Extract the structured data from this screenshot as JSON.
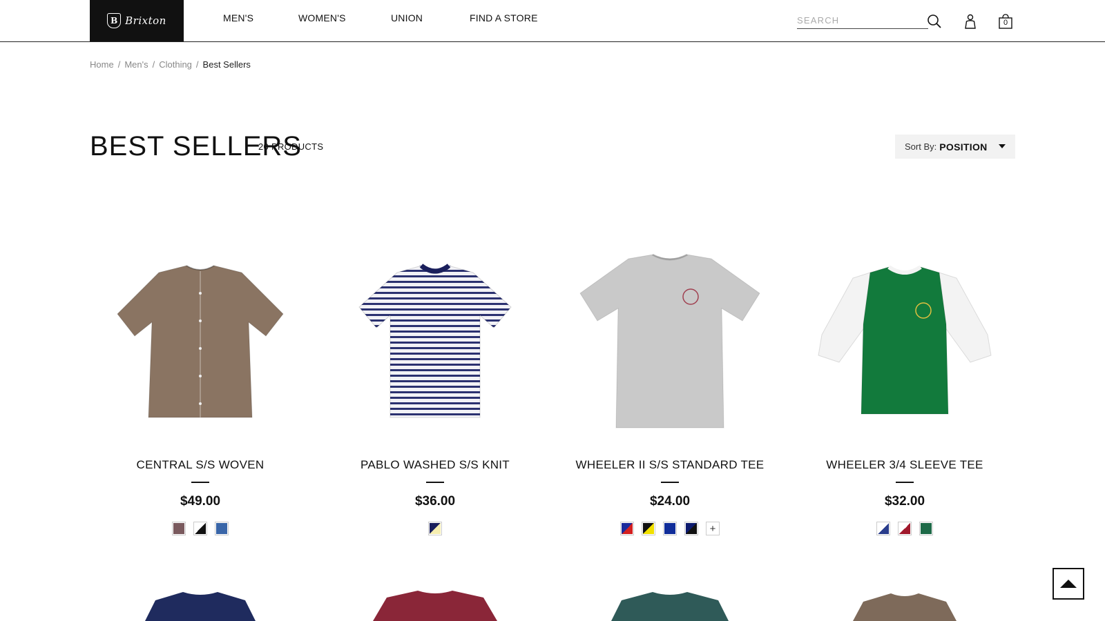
{
  "header": {
    "logo_text": "Brixton",
    "logo_mark": "B",
    "nav": [
      {
        "label": "MEN'S"
      },
      {
        "label": "WOMEN'S"
      },
      {
        "label": "UNION"
      },
      {
        "label": "FIND A STORE"
      }
    ],
    "search_placeholder": "SEARCH",
    "search_icon": "search-icon",
    "account_icon": "user-icon",
    "cart_icon": "bag-icon",
    "cart_count": "0"
  },
  "breadcrumb": {
    "items": [
      {
        "label": "Home"
      },
      {
        "label": "Men's"
      },
      {
        "label": "Clothing"
      }
    ],
    "separator": "/",
    "current": "Best Sellers"
  },
  "page": {
    "title": "BEST SELLERS",
    "count": "20 PRODUCTS",
    "sort_label": "Sort By:",
    "sort_value": "POSITION"
  },
  "products": [
    {
      "name": "CENTRAL S/S WOVEN",
      "price": "$49.00",
      "shirt_color": "#8a7462",
      "swatches": [
        [
          "#7a5a5e",
          "#7a5a5e"
        ],
        [
          "#ffffff",
          "#111111"
        ],
        [
          "#3a66a8",
          "#3a66a8"
        ]
      ]
    },
    {
      "name": "PABLO WASHED S/S KNIT",
      "price": "$36.00",
      "shirt_color": "#9aa0c0",
      "swatches": [
        [
          "#1a1f5c",
          "#f6eeb0"
        ]
      ]
    },
    {
      "name": "WHEELER II S/S STANDARD TEE",
      "price": "$24.00",
      "shirt_color": "#c9c9c9",
      "swatches": [
        [
          "#1a2a9c",
          "#d42020"
        ],
        [
          "#111111",
          "#f1e000"
        ],
        [
          "#112e9a",
          "#112e9a"
        ],
        [
          "#0d1b6e",
          "#111111"
        ]
      ],
      "has_more": true,
      "more_label": "+"
    },
    {
      "name": "WHEELER 3/4 SLEEVE TEE",
      "price": "$32.00",
      "shirt_color": "#127a3c",
      "swatches": [
        [
          "#ffffff",
          "#2a3d8c"
        ],
        [
          "#ffffff",
          "#a0182c"
        ],
        [
          "#1e6a48",
          "#1e6a48"
        ]
      ]
    }
  ],
  "peek_colors": [
    "#1f2b5e",
    "#8a2638",
    "#2f5a58",
    "#7e6a5a"
  ],
  "back_to_top_icon": "arrow-up-icon"
}
